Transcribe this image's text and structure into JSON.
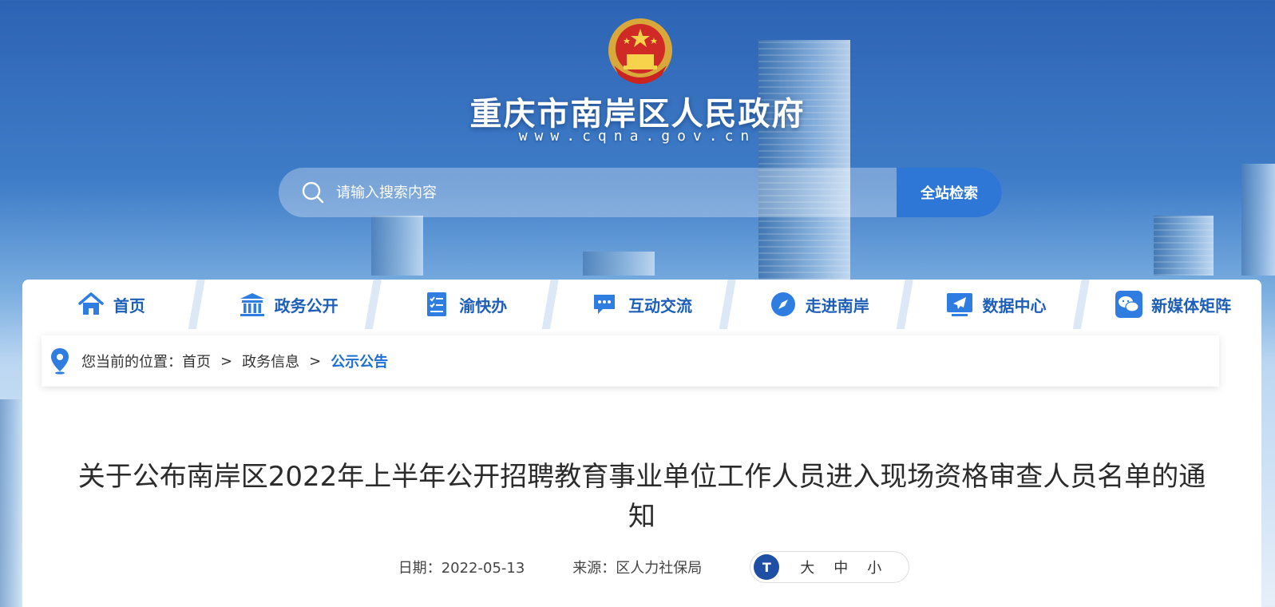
{
  "header": {
    "emblem_icon": "national-emblem-icon",
    "title": "重庆市南岸区人民政府",
    "url": "www.cqna.gov.cn"
  },
  "search": {
    "placeholder": "请输入搜索内容",
    "button_label": "全站检索",
    "accent_color": "#2e77d6"
  },
  "nav": {
    "items": [
      {
        "label": "首页",
        "icon": "home-icon"
      },
      {
        "label": "政务公开",
        "icon": "government-building-icon"
      },
      {
        "label": "渝快办",
        "icon": "checklist-icon"
      },
      {
        "label": "互动交流",
        "icon": "chat-bubble-icon"
      },
      {
        "label": "走进南岸",
        "icon": "compass-icon"
      },
      {
        "label": "数据中心",
        "icon": "paper-plane-icon"
      },
      {
        "label": "新媒体矩阵",
        "icon": "wechat-icon"
      }
    ]
  },
  "breadcrumb": {
    "prefix": "您当前的位置：",
    "items": [
      "首页",
      "政务信息"
    ],
    "separator": ">",
    "current": "公示公告"
  },
  "article": {
    "title": "关于公布南岸区2022年上半年公开招聘教育事业单位工作人员进入现场资格审查人员名单的通知",
    "date_label": "日期：",
    "date": "2022-05-13",
    "source_label": "来源：",
    "source": "区人力社保局",
    "font_size": {
      "icon_label": "T",
      "options": [
        "大",
        "中",
        "小"
      ]
    }
  }
}
